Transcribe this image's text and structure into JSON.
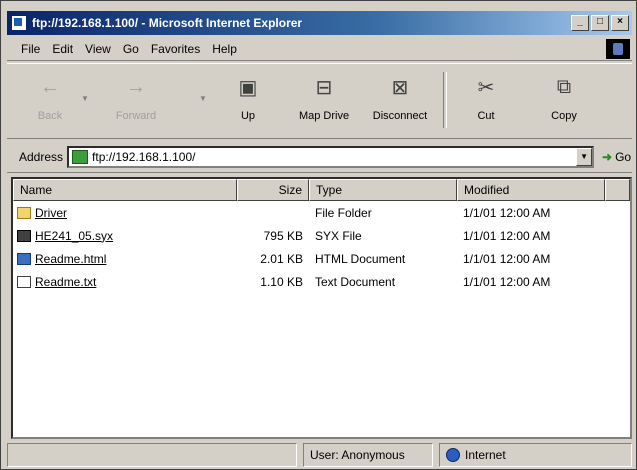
{
  "window": {
    "title": "ftp://192.168.1.100/ - Microsoft Internet Explorer"
  },
  "menu": [
    "File",
    "Edit",
    "View",
    "Go",
    "Favorites",
    "Help"
  ],
  "toolbar": {
    "back": "Back",
    "forward": "Forward",
    "up": "Up",
    "map_drive": "Map Drive",
    "disconnect": "Disconnect",
    "cut": "Cut",
    "copy": "Copy"
  },
  "address": {
    "label": "Address",
    "value": "ftp://192.168.1.100/",
    "go": "Go"
  },
  "columns": {
    "name": "Name",
    "size": "Size",
    "type": "Type",
    "modified": "Modified"
  },
  "files": [
    {
      "name": "Driver",
      "size": "",
      "type": "File Folder",
      "modified": "1/1/01 12:00 AM",
      "icon": "folder-icon"
    },
    {
      "name": "HE241_05.syx",
      "size": "795 KB",
      "type": "SYX File",
      "modified": "1/1/01 12:00 AM",
      "icon": "system-file-icon"
    },
    {
      "name": "Readme.html",
      "size": "2.01 KB",
      "type": "HTML Document",
      "modified": "1/1/01 12:00 AM",
      "icon": "html-document-icon"
    },
    {
      "name": "Readme.txt",
      "size": "1.10 KB",
      "type": "Text Document",
      "modified": "1/1/01 12:00 AM",
      "icon": "text-document-icon"
    }
  ],
  "status": {
    "user": "User: Anonymous",
    "zone": "Internet"
  }
}
